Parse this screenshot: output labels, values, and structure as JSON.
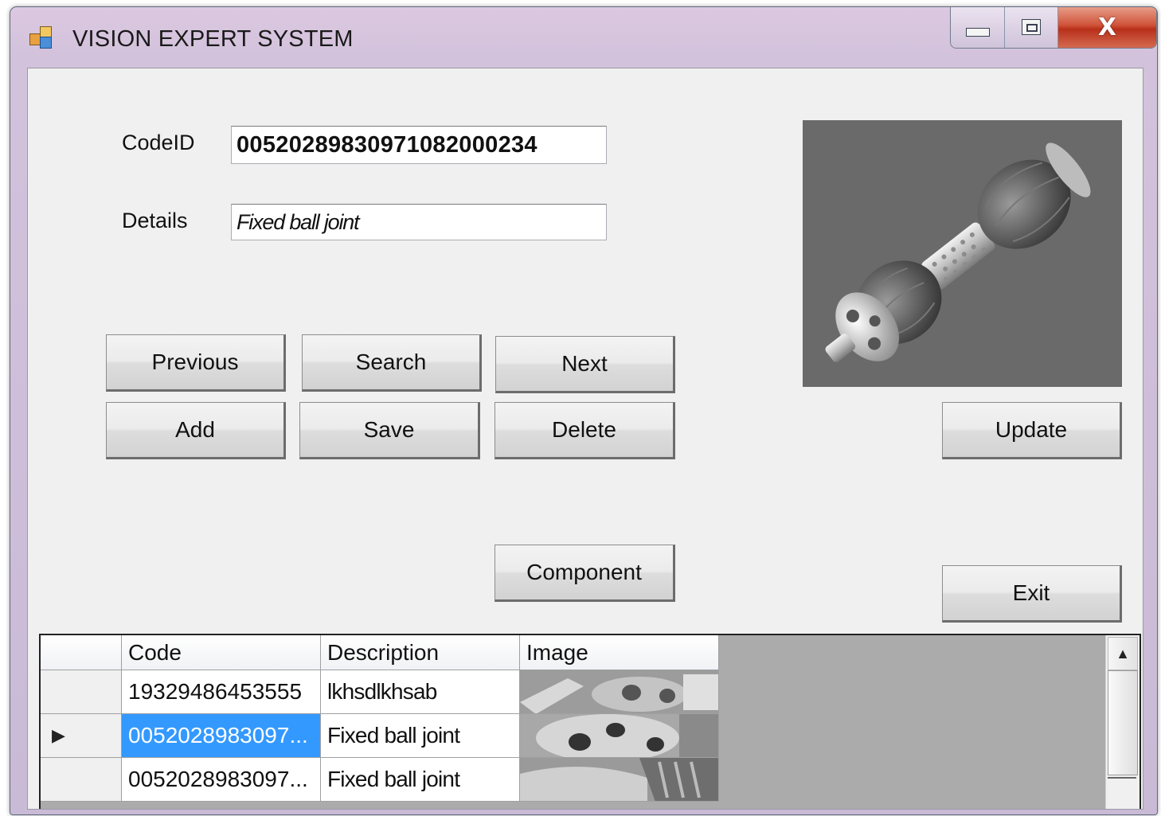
{
  "window": {
    "title": "VISION EXPERT SYSTEM",
    "icons": {
      "app": "app-form-icon",
      "minimize": "minimize-icon",
      "maximize": "maximize-icon",
      "close": "close-icon"
    },
    "close_glyph": "X"
  },
  "form": {
    "codeid_label": "CodeID",
    "codeid_value": "00520289830971082000234",
    "details_label": "Details",
    "details_value": "Fixed ball joint",
    "image_description": "drive-shaft-photo"
  },
  "buttons": {
    "previous": "Previous",
    "search": "Search",
    "next": "Next",
    "add": "Add",
    "save": "Save",
    "delete": "Delete",
    "update": "Update",
    "component": "Component",
    "exit": "Exit"
  },
  "grid": {
    "columns": [
      "Code",
      "Description",
      "Image"
    ],
    "rows": [
      {
        "code": "19329486453555",
        "description": "lkhsdlkhsab",
        "image": "part-thumbnail",
        "selected": false,
        "current": false
      },
      {
        "code": "0052028983097...",
        "description": "Fixed ball joint",
        "image": "part-thumbnail",
        "selected": true,
        "current": true
      },
      {
        "code": "0052028983097...",
        "description": "Fixed ball joint",
        "image": "part-thumbnail",
        "selected": false,
        "current": false
      }
    ],
    "current_row_glyph": "▶",
    "scroll_up_glyph": "▲"
  },
  "colors": {
    "selection": "#3399ff",
    "close_button": "#c8452c",
    "client_bg": "#f0f0f0",
    "grid_empty": "#ababab"
  }
}
